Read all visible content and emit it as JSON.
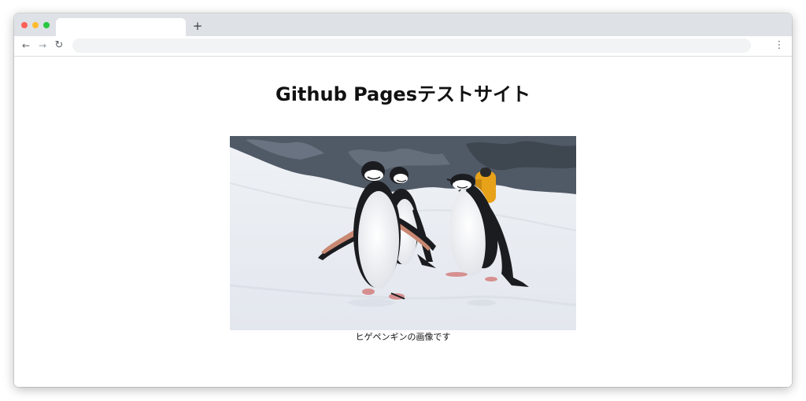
{
  "browser": {
    "tabs": [
      {
        "label": ""
      }
    ],
    "new_tab_label": "+",
    "address_bar": {
      "value": ""
    },
    "icons": {
      "back": "arrow-left-icon",
      "forward": "arrow-right-icon",
      "reload": "reload-icon",
      "menu": "kebab-menu-icon"
    },
    "colors": {
      "close": "#fe5f57",
      "minimize": "#febc2e",
      "maximize": "#28c840"
    }
  },
  "page": {
    "title": "Github Pagesテストサイト",
    "image": {
      "subject": "chinstrap penguins on snow"
    },
    "caption": "ヒゲペンギンの画像です"
  }
}
